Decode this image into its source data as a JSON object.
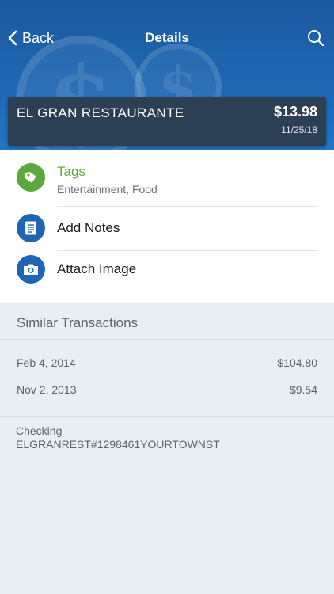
{
  "nav": {
    "back_label": "Back",
    "title": "Details"
  },
  "merchant": {
    "name": "EL GRAN RESTAURANTE",
    "amount": "$13.98",
    "date": "11/25/18"
  },
  "actions": {
    "tags": {
      "title": "Tags",
      "subtitle": "Entertainment, Food",
      "icon": "tag-icon",
      "color": "#5da83d"
    },
    "notes": {
      "title": "Add Notes",
      "icon": "notes-icon"
    },
    "image": {
      "title": "Attach Image",
      "icon": "camera-icon"
    }
  },
  "similar": {
    "title": "Similar Transactions",
    "rows": [
      {
        "date": "Feb 4, 2014",
        "amount": "$104.80"
      },
      {
        "date": "Nov 2, 2013",
        "amount": "$9.54"
      }
    ]
  },
  "account": {
    "type": "Checking",
    "description": "ELGRANREST#1298461YOURTOWNST"
  },
  "colors": {
    "brand_blue": "#1e66b2",
    "merchant_bar": "#2c3f55",
    "tag_green": "#5da83d",
    "background": "#e9eef4"
  }
}
